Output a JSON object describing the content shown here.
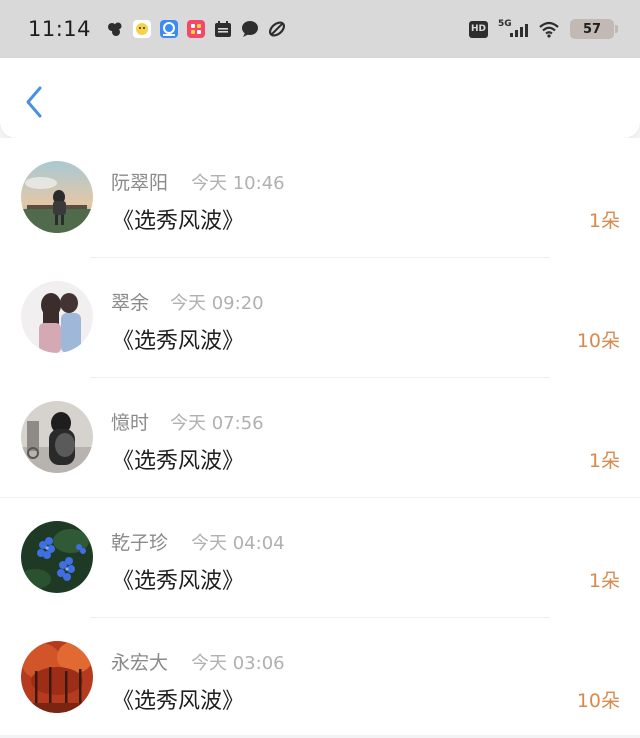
{
  "status_bar": {
    "time": "11:14",
    "network": "5G",
    "hd": "HD",
    "battery": "57",
    "icons": [
      "app-icon",
      "smiley-app-icon",
      "browser-app-icon",
      "grid-app-icon",
      "calendar-icon",
      "chat-bubble-icon",
      "leaf-icon"
    ]
  },
  "header": {
    "back_icon": "chevron-left-icon"
  },
  "colors": {
    "accent": "#4a90e2",
    "amount": "#d88a4e",
    "name": "#8a8a8a",
    "timestamp": "#b0b0b0"
  },
  "records": [
    {
      "name": "阮翠阳",
      "time": "今天 10:46",
      "title": "《选秀风波》",
      "amount": "1朵",
      "avatar": "landscape-girl-avatar"
    },
    {
      "name": "翠余",
      "time": "今天 09:20",
      "title": "《选秀风波》",
      "amount": "10朵",
      "avatar": "couple-avatar"
    },
    {
      "name": "憶时",
      "time": "今天 07:56",
      "title": "《选秀风波》",
      "amount": "1朵",
      "avatar": "bw-girl-avatar"
    },
    {
      "name": "乾子珍",
      "time": "今天 04:04",
      "title": "《选秀风波》",
      "amount": "1朵",
      "avatar": "blue-flower-avatar"
    },
    {
      "name": "永宏大",
      "time": "今天 03:06",
      "title": "《选秀风波》",
      "amount": "10朵",
      "avatar": "red-forest-avatar"
    }
  ]
}
